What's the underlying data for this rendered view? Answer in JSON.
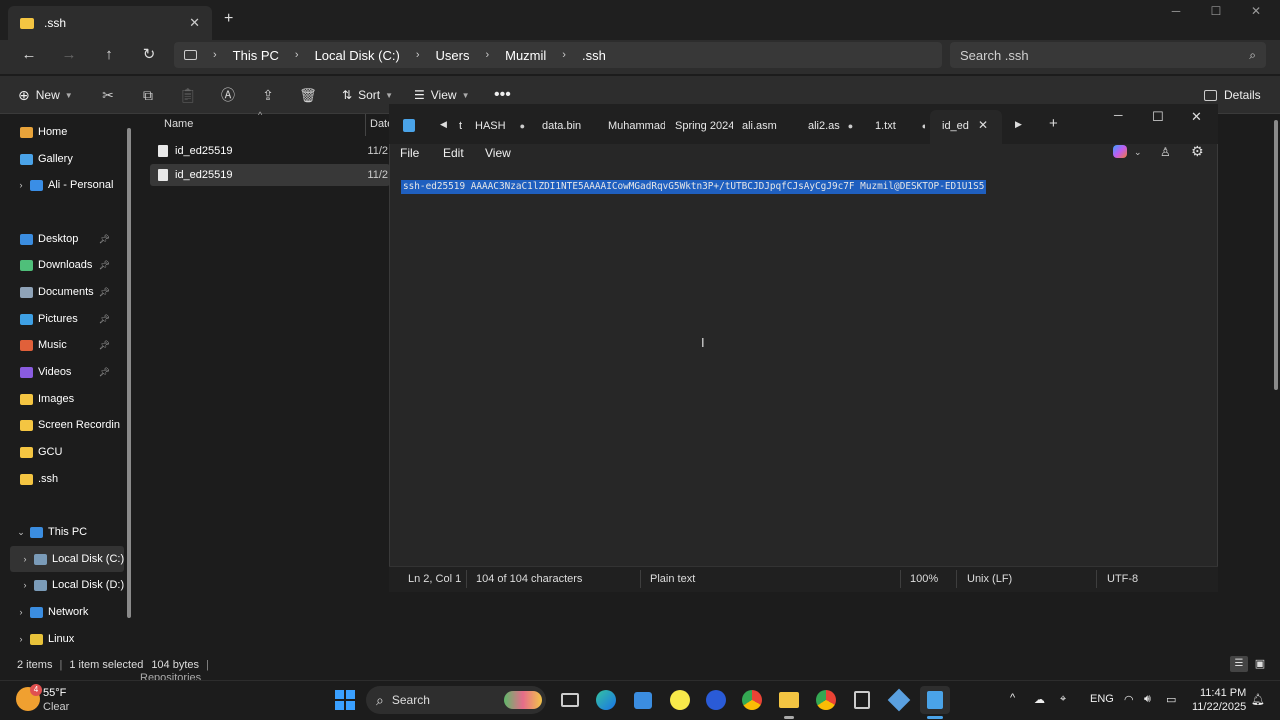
{
  "explorer": {
    "tab_title": ".ssh",
    "breadcrumb": [
      "This PC",
      "Local Disk (C:)",
      "Users",
      "Muzmil",
      ".ssh"
    ],
    "search_placeholder": "Search .ssh",
    "toolbar": {
      "new": "New",
      "sort": "Sort",
      "view": "View",
      "details": "Details"
    },
    "columns": {
      "name": "Name",
      "date": "Date"
    },
    "files": [
      {
        "name": "id_ed25519",
        "date": "11/2"
      },
      {
        "name": "id_ed25519",
        "date": "11/2"
      }
    ],
    "sidebar": [
      {
        "label": "Home",
        "color": "#e8a33a"
      },
      {
        "label": "Gallery",
        "color": "#4aa3e8"
      },
      {
        "label": "Ali - Personal",
        "color": "#3a8ee6"
      },
      {
        "label": "Desktop",
        "color": "#3b8de0"
      },
      {
        "label": "Downloads",
        "color": "#4fbf7a"
      },
      {
        "label": "Documents",
        "color": "#8fa3b8"
      },
      {
        "label": "Pictures",
        "color": "#3ea0e4"
      },
      {
        "label": "Music",
        "color": "#e0603a"
      },
      {
        "label": "Videos",
        "color": "#8a5ce0"
      },
      {
        "label": "Images",
        "color": "#f4c542"
      },
      {
        "label": "Screen Recordin",
        "color": "#f4c542"
      },
      {
        "label": "GCU",
        "color": "#f4c542"
      },
      {
        "label": ".ssh",
        "color": "#f4c542"
      },
      {
        "label": "This PC",
        "color": "#3b8de0"
      },
      {
        "label": "Local Disk (C:)",
        "color": "#7a9bb8"
      },
      {
        "label": "Local Disk (D:)",
        "color": "#7a9bb8"
      },
      {
        "label": "Network",
        "color": "#3b8de0"
      },
      {
        "label": "Linux",
        "color": "#e8c23a"
      }
    ],
    "status": {
      "items": "2 items",
      "selected": "1 item selected",
      "size": "104 bytes"
    },
    "partial_item": "Repositories"
  },
  "notepad": {
    "tabs": [
      "t",
      "HASH",
      "data.bin",
      "Muhammad",
      "Spring 2024",
      "ali.asm",
      "ali2.as",
      "1.txt",
      "id_ed"
    ],
    "menu": [
      "File",
      "Edit",
      "View"
    ],
    "content": "ssh-ed25519 AAAAC3NzaC1lZDI1NTE5AAAAICowMGadRqvG5Wktn3P+/tUTBCJDJpqfCJsAyCgJ9c7F Muzmil@DESKTOP-ED1U1S5",
    "status": {
      "position": "Ln 2, Col 1",
      "chars": "104 of 104 characters",
      "type": "Plain text",
      "zoom": "100%",
      "eol": "Unix (LF)",
      "encoding": "UTF-8"
    }
  },
  "taskbar": {
    "weather": {
      "temp": "55°F",
      "desc": "Clear",
      "badge": "4"
    },
    "search": "Search",
    "lang": "ENG",
    "time": "11:41 PM",
    "date": "11/22/2025"
  }
}
